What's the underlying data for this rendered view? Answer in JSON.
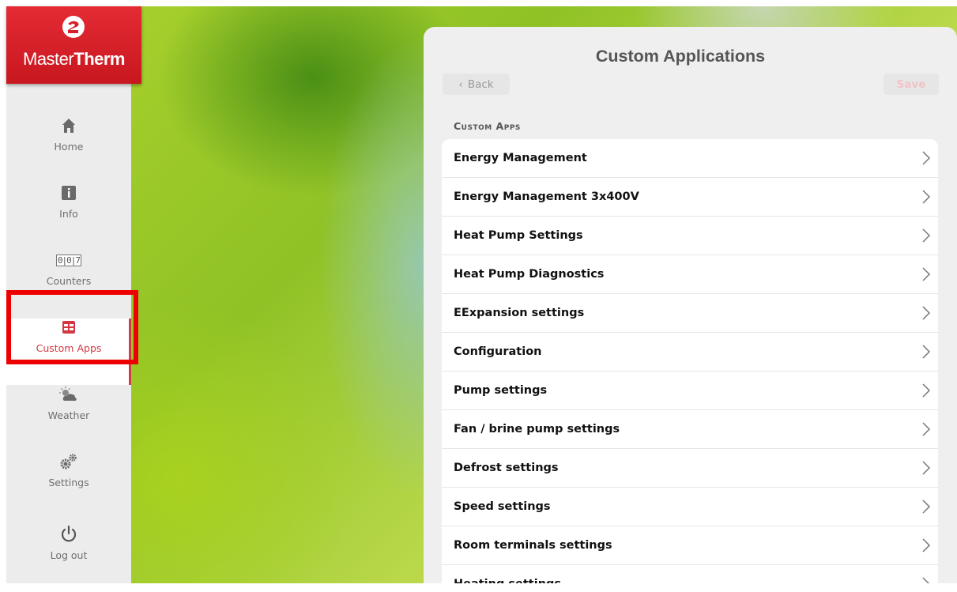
{
  "brand": {
    "name_part1": "Master",
    "name_part2": "Therm",
    "color": "#d7202a"
  },
  "sidebar": {
    "items": [
      {
        "label": "Home",
        "icon": "home-icon",
        "active": false
      },
      {
        "label": "Info",
        "icon": "info-icon",
        "active": false
      },
      {
        "label": "Counters",
        "icon": "counter-icon",
        "active": false
      },
      {
        "label": "Custom Apps",
        "icon": "custom-apps-icon",
        "active": true
      },
      {
        "label": "Weather",
        "icon": "weather-icon",
        "active": false
      },
      {
        "label": "Settings",
        "icon": "gears-icon",
        "active": false
      },
      {
        "label": "Log out",
        "icon": "power-icon",
        "active": false
      }
    ],
    "counter_digits": "0|0|7",
    "active_color": "#d23742",
    "highlight_color": "#ee0000"
  },
  "panel": {
    "title": "Custom Applications",
    "back_label": "Back",
    "save_label": "Save",
    "section_header": "Custom Apps",
    "items": [
      "Energy Management",
      "Energy Management 3x400V",
      "Heat Pump Settings",
      "Heat Pump Diagnostics",
      "EExpansion settings",
      "Configuration",
      "Pump settings",
      "Fan / brine pump settings",
      "Defrost settings",
      "Speed settings",
      "Room terminals settings",
      "Heating settings"
    ]
  }
}
